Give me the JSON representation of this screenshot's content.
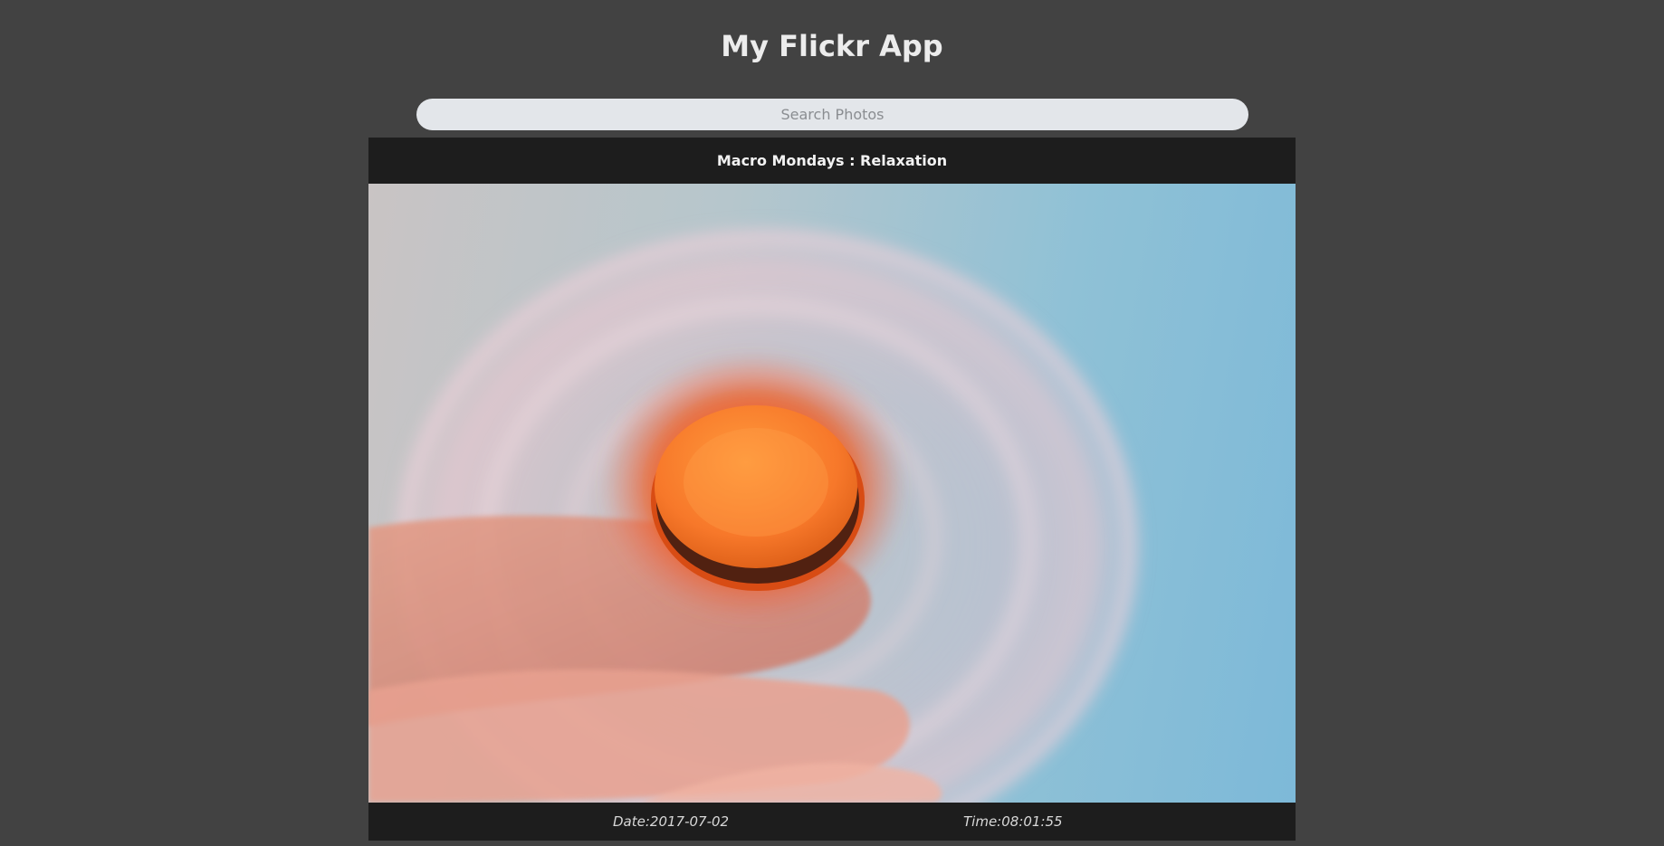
{
  "header": {
    "title": "My Flickr App"
  },
  "search": {
    "placeholder": "Search Photos",
    "value": ""
  },
  "photo": {
    "title": "Macro Mondays : Relaxation",
    "image_subject": "orange-fidget-spinner-on-finger",
    "date_label": "Date:",
    "date_value": "2017-07-02",
    "time_label": "Time:",
    "time_value": "08:01:55"
  },
  "colors": {
    "page_background": "#424242",
    "card_background": "#1d1d1d",
    "search_background": "#e3e6ea",
    "title_text": "#ececec"
  }
}
